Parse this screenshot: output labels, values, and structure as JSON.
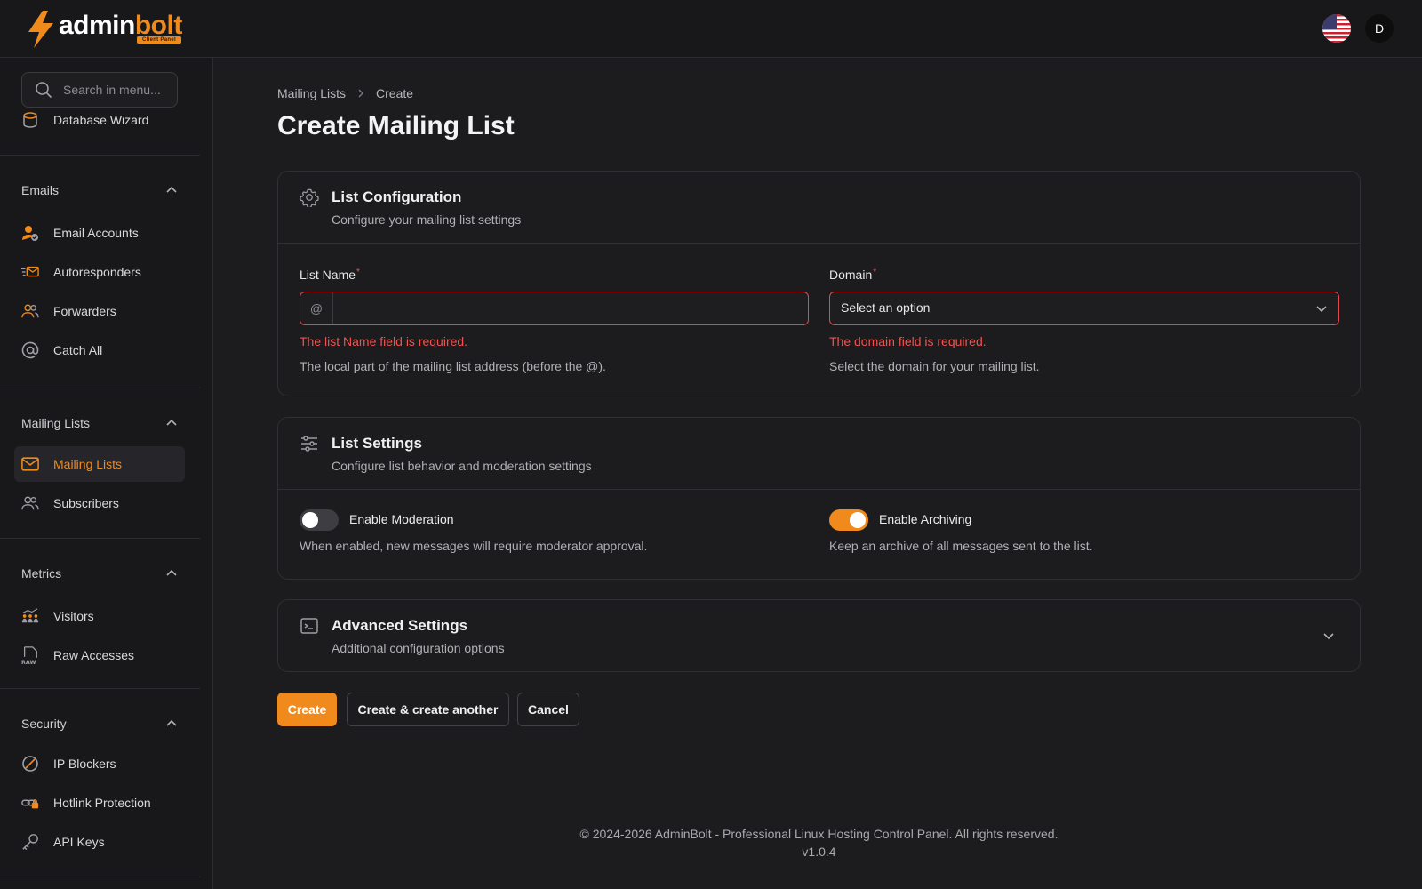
{
  "header": {
    "logo_text_main": "admin",
    "logo_text_accent": "bolt",
    "logo_badge": "Client Panel",
    "user_initial": "D",
    "flag": "us-flag"
  },
  "sidebar": {
    "search_placeholder": "Search in menu...",
    "partial_item": "Database Wizard",
    "groups": [
      {
        "label": "Emails",
        "items": [
          "Email Accounts",
          "Autoresponders",
          "Forwarders",
          "Catch All"
        ]
      },
      {
        "label": "Mailing Lists",
        "items": [
          "Mailing Lists",
          "Subscribers"
        ]
      },
      {
        "label": "Metrics",
        "items": [
          "Visitors",
          "Raw Accesses"
        ]
      },
      {
        "label": "Security",
        "items": [
          "IP Blockers",
          "Hotlink Protection",
          "API Keys"
        ]
      }
    ],
    "active_item": "Mailing Lists"
  },
  "breadcrumb": [
    "Mailing Lists",
    "Create"
  ],
  "page_title": "Create Mailing List",
  "list_config": {
    "title": "List Configuration",
    "subtitle": "Configure your mailing list settings",
    "list_name_label": "List Name",
    "list_name_prefix": "@",
    "list_name_value": "",
    "list_name_error": "The list Name field is required.",
    "list_name_help": "The local part of the mailing list address (before the @).",
    "domain_label": "Domain",
    "domain_value": "Select an option",
    "domain_error": "The domain field is required.",
    "domain_help": "Select the domain for your mailing list.",
    "required_mark": "*"
  },
  "list_settings": {
    "title": "List Settings",
    "subtitle": "Configure list behavior and moderation settings",
    "moderation_label": "Enable Moderation",
    "moderation_enabled": false,
    "moderation_help": "When enabled, new messages will require moderator approval.",
    "archiving_label": "Enable Archiving",
    "archiving_enabled": true,
    "archiving_help": "Keep an archive of all messages sent to the list."
  },
  "advanced": {
    "title": "Advanced Settings",
    "subtitle": "Additional configuration options"
  },
  "actions": {
    "create": "Create",
    "create_another": "Create & create another",
    "cancel": "Cancel"
  },
  "footer": {
    "copyright": "© 2024-2026 AdminBolt - Professional Linux Hosting Control Panel. All rights reserved.",
    "version": "v1.0.4"
  },
  "colors": {
    "accent": "#f08a1c",
    "error": "#ef5350",
    "background": "#1c1c1e"
  }
}
